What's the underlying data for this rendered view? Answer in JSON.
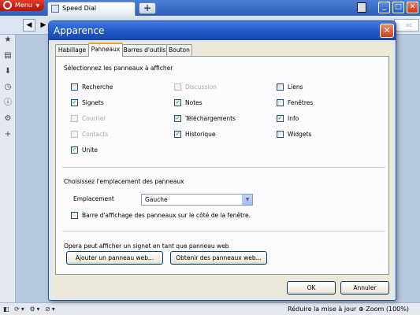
{
  "browser": {
    "menu_label": "Menu",
    "tab_title": "Speed Dial",
    "newtab_label": "+",
    "search_stub": "oc"
  },
  "statusbar": {
    "reduce_label": "Réduire la mise à jour",
    "zoom_label": "Zoom (100%)"
  },
  "dialog": {
    "title": "Apparence",
    "tabs": [
      "Habillage",
      "Panneaux",
      "Barres d'outils",
      "Bouton"
    ],
    "active_tab": "Panneaux",
    "section1_title": "Sélectionnez les panneaux à afficher",
    "panels": [
      {
        "label": "Recherche",
        "checked": false,
        "enabled": true
      },
      {
        "label": "Discussion",
        "checked": false,
        "enabled": false
      },
      {
        "label": "Liens",
        "checked": false,
        "enabled": true
      },
      {
        "label": "Signets",
        "checked": true,
        "enabled": true
      },
      {
        "label": "Notes",
        "checked": true,
        "enabled": true
      },
      {
        "label": "Fenêtres",
        "checked": false,
        "enabled": true
      },
      {
        "label": "Courrier",
        "checked": false,
        "enabled": false
      },
      {
        "label": "Téléchargements",
        "checked": true,
        "enabled": true
      },
      {
        "label": "Info",
        "checked": true,
        "enabled": true
      },
      {
        "label": "Contacts",
        "checked": false,
        "enabled": false
      },
      {
        "label": "Historique",
        "checked": true,
        "enabled": true
      },
      {
        "label": "Widgets",
        "checked": false,
        "enabled": true
      },
      {
        "label": "Unite",
        "checked": true,
        "enabled": true
      }
    ],
    "section2_title": "Choisissez l'emplacement des panneaux",
    "location_label": "Emplacement",
    "location_value": "Gauche",
    "sidebar_toggle_label": "Barre d'affichage des panneaux sur le côté de la fenêtre.",
    "sidebar_toggle_checked": false,
    "section3_title": "Opera peut afficher un signet en tant que panneau web",
    "add_webpanel_label": "Ajouter un panneau web...",
    "get_webpanels_label": "Obtenir des panneaux web...",
    "ok_label": "OK",
    "cancel_label": "Annuler"
  },
  "colors": {
    "title_blue": "#1f55c4",
    "dialog_bg": "#ece9d8",
    "check_green": "#21a121",
    "close_red": "#cc4019"
  }
}
